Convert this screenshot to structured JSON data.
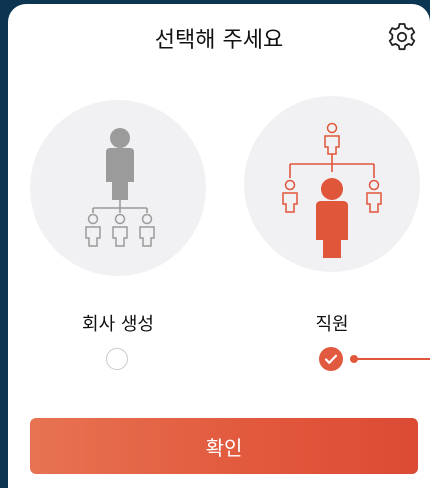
{
  "header": {
    "title": "선택해 주세요",
    "settings_icon": "gear-icon"
  },
  "options": [
    {
      "label": "회사 생성",
      "icon": "company-hierarchy-icon",
      "selected": false,
      "color": "#9b9b9b"
    },
    {
      "label": "직원",
      "icon": "employee-hierarchy-icon",
      "selected": true,
      "color": "#e0563b"
    }
  ],
  "confirm_button": {
    "label": "확인"
  },
  "colors": {
    "accent": "#e0573c",
    "background": "#0b3550",
    "circle": "#f1f1f3"
  }
}
